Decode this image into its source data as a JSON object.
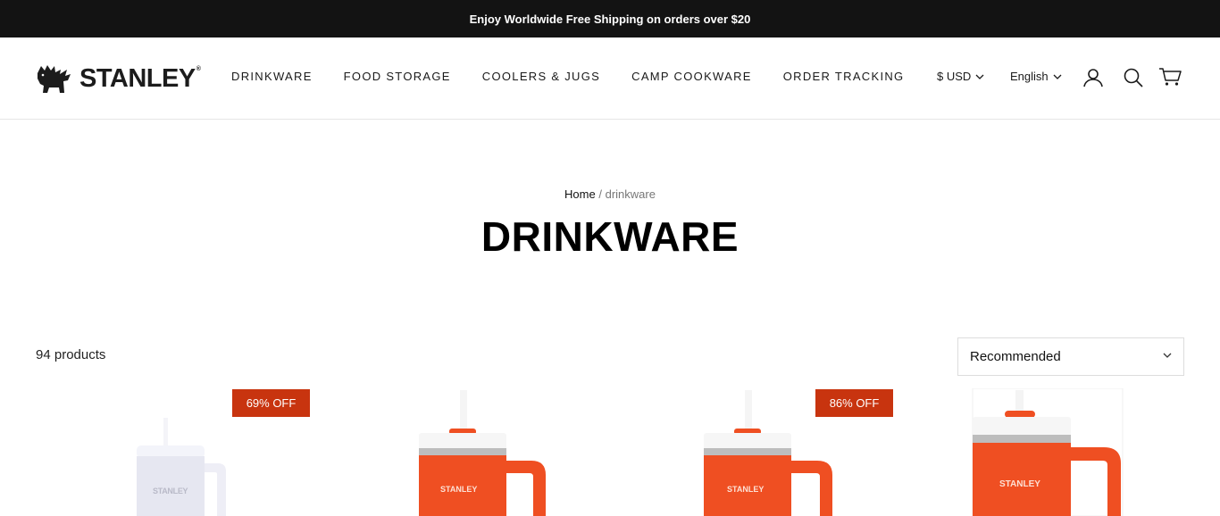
{
  "announcement": "Enjoy Worldwide Free Shipping on orders over $20",
  "brand": {
    "name": "STANLEY",
    "reg": "®"
  },
  "nav": [
    "DRINKWARE",
    "FOOD STORAGE",
    "COOLERS & JUGS",
    "CAMP COOKWARE",
    "ORDER TRACKING"
  ],
  "currency": "$ USD",
  "language": "English",
  "icons": {
    "account": "account-icon",
    "search": "search-icon",
    "cart": "cart-icon",
    "chevron": "chevron-down-icon"
  },
  "breadcrumb": {
    "home": "Home",
    "separator": "/",
    "current": "drinkware"
  },
  "page_title": "DRINKWARE",
  "products_count": "94 products",
  "sort": {
    "selected": "Recommended"
  },
  "products": [
    {
      "badge": "69% OFF",
      "color": "white",
      "logo": "STANLEY"
    },
    {
      "badge": "",
      "color": "orange",
      "logo": "STANLEY"
    },
    {
      "badge": "86% OFF",
      "color": "orange",
      "logo": "STANLEY"
    },
    {
      "badge": "",
      "color": "orange",
      "logo": "STANLEY"
    }
  ],
  "colors": {
    "announce_bg": "#131313",
    "badge_bg": "#c8340f",
    "orange": "#ef4f22",
    "white_tumbler": "#e6e7f1"
  }
}
